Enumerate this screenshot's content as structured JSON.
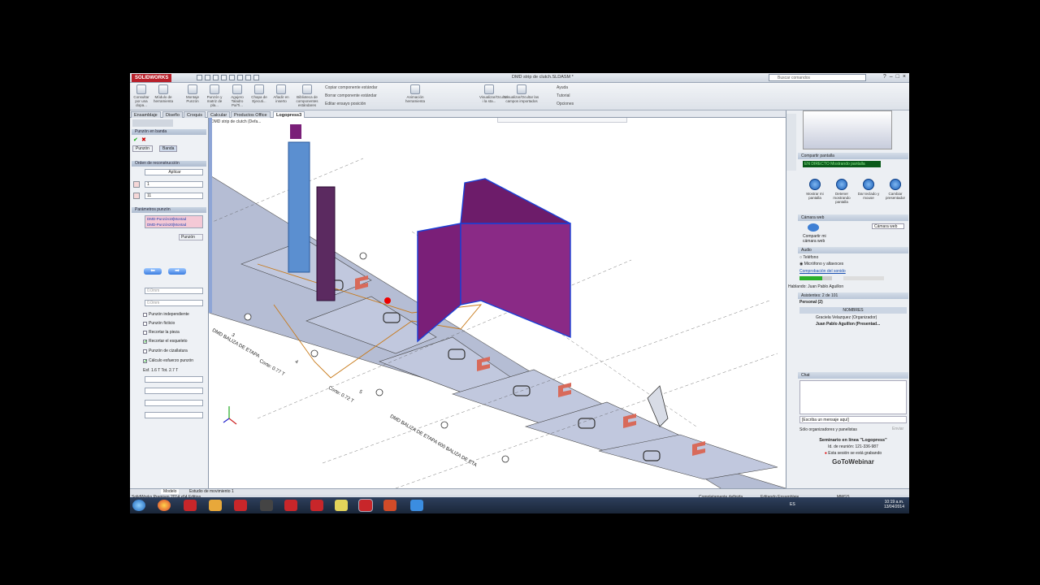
{
  "app": {
    "logo": "SOLIDWORKS",
    "doc_title": "DMD strip de clutch.SLDASM *",
    "search_placeholder": "Buscar comandos"
  },
  "ribbon": {
    "buttons": [
      "Consultar por una dopa...",
      "Módulo de herramienta",
      "Montaje Punzón",
      "Punzón y matriz de pla...",
      "Agujero Taladro Pa/Ti...",
      "Chapa de Ejecuti...",
      "Añadir en inserto",
      "Biblioteca de componentes estándares",
      "Animación herramienta",
      "Visualizar/Ocultar i la sta...",
      "Visualizar/Ocultar las campos importados"
    ],
    "small_items": [
      "Copiar componente estándar",
      "Borrar componente estándar",
      "Editar ensayo posición"
    ],
    "help": [
      "Ayuda",
      "Tutorial",
      "Opciones"
    ]
  },
  "tabs": [
    "Ensamblaje",
    "Diseño",
    "Croquis",
    "Calcular",
    "Productos Office",
    "Logopress3"
  ],
  "tree_item": "DMD strip de clutch (Defa...",
  "left": {
    "panel_title": "Punzón en banda",
    "subtabs": [
      "Punzón",
      "Banda"
    ],
    "sec1": "Orden de reconstrucción",
    "apply": "Aplicar",
    "field1": "1",
    "field2": "11",
    "sec2": "Parámetros punzón",
    "punch_list": [
      "DMD-Punzón19[Montad",
      "DMD-Punzón20[Montad"
    ],
    "punch_label": "Punzón",
    "dist1": "0.0mm",
    "dist2": "0.0mm",
    "checks": [
      {
        "label": "Punzón independiente",
        "checked": false
      },
      {
        "label": "Punzón ficticio",
        "checked": false
      },
      {
        "label": "Recortar la pieza",
        "checked": false
      },
      {
        "label": "Recortar el esqueleto",
        "checked": true
      },
      {
        "label": "Punzón de cizallatura",
        "checked": false
      },
      {
        "label": "Cálculo esfuerzo punzón",
        "checked": true
      }
    ],
    "effort": "Esf. 1.6 T  Tot. 2.7 T"
  },
  "viewport": {
    "cut_labels": [
      "Corte: 0.77 T",
      "Corte: 0.72 T"
    ],
    "station_labels": [
      "3",
      "4",
      "5"
    ],
    "band_text": [
      "DMD BALIZA DE ETAPA",
      "DMD BALIZA DE ETAPA 600 BALIZA DE ETA"
    ]
  },
  "right": {
    "share_title": "Compartir pantalla",
    "live": "EN DIRECTO  Mostrando pantalla",
    "share_buttons": [
      "Mostrar mi pantalla",
      "Detener mostrando pantalla",
      "Dar teclado y mouse",
      "Cambiar presentador"
    ],
    "share_select": "pantalla",
    "webcam_title": "Cámara web",
    "webcam_btn": "Compartir mi cámara web",
    "webcam_select": "Cámara web",
    "audio_title": "Audio",
    "audio_opt1": "Teléfono",
    "audio_opt2": "Micrófono y altavoces",
    "sound_check": "Comprobación del sonido",
    "speaking": "Hablando: Juan Pablo Aguillon",
    "attendees_title": "Asistentes: 2 de 101",
    "staff": "Personal (2)",
    "names_header": "NOMBRES",
    "names": [
      "Graciela Velazquez (Organizador)",
      "Juan Pablo Aguillon (Presentad..."
    ],
    "chat_title": "Chat",
    "chat_placeholder": "[Escriba un mensaje aquí]",
    "chat_to": "Sólo organizadores y panelistas",
    "send": "Enviar",
    "webinar": "Seminario en línea \"Logopress\"",
    "meeting_id": "Id. de reunión: 121-336-987",
    "recording": "Esta sesión se está grabando",
    "brand": "GoToWebinar"
  },
  "model_tabs": [
    "Modelo",
    "Estudio de movimiento 1"
  ],
  "status": {
    "left": "SolidWorks Premium 2014 x64 Edition",
    "mid": "Completamente definida",
    "mid2": "Editando Ensamblaje",
    "units": "MMGS"
  },
  "taskbar": {
    "lang": "ES",
    "time": "10:19 a.m.",
    "date": "13/04/2014"
  },
  "colors": {
    "purple": "#7a1f78",
    "blue": "#1a3fd6",
    "strip": "#b8bfd6"
  }
}
